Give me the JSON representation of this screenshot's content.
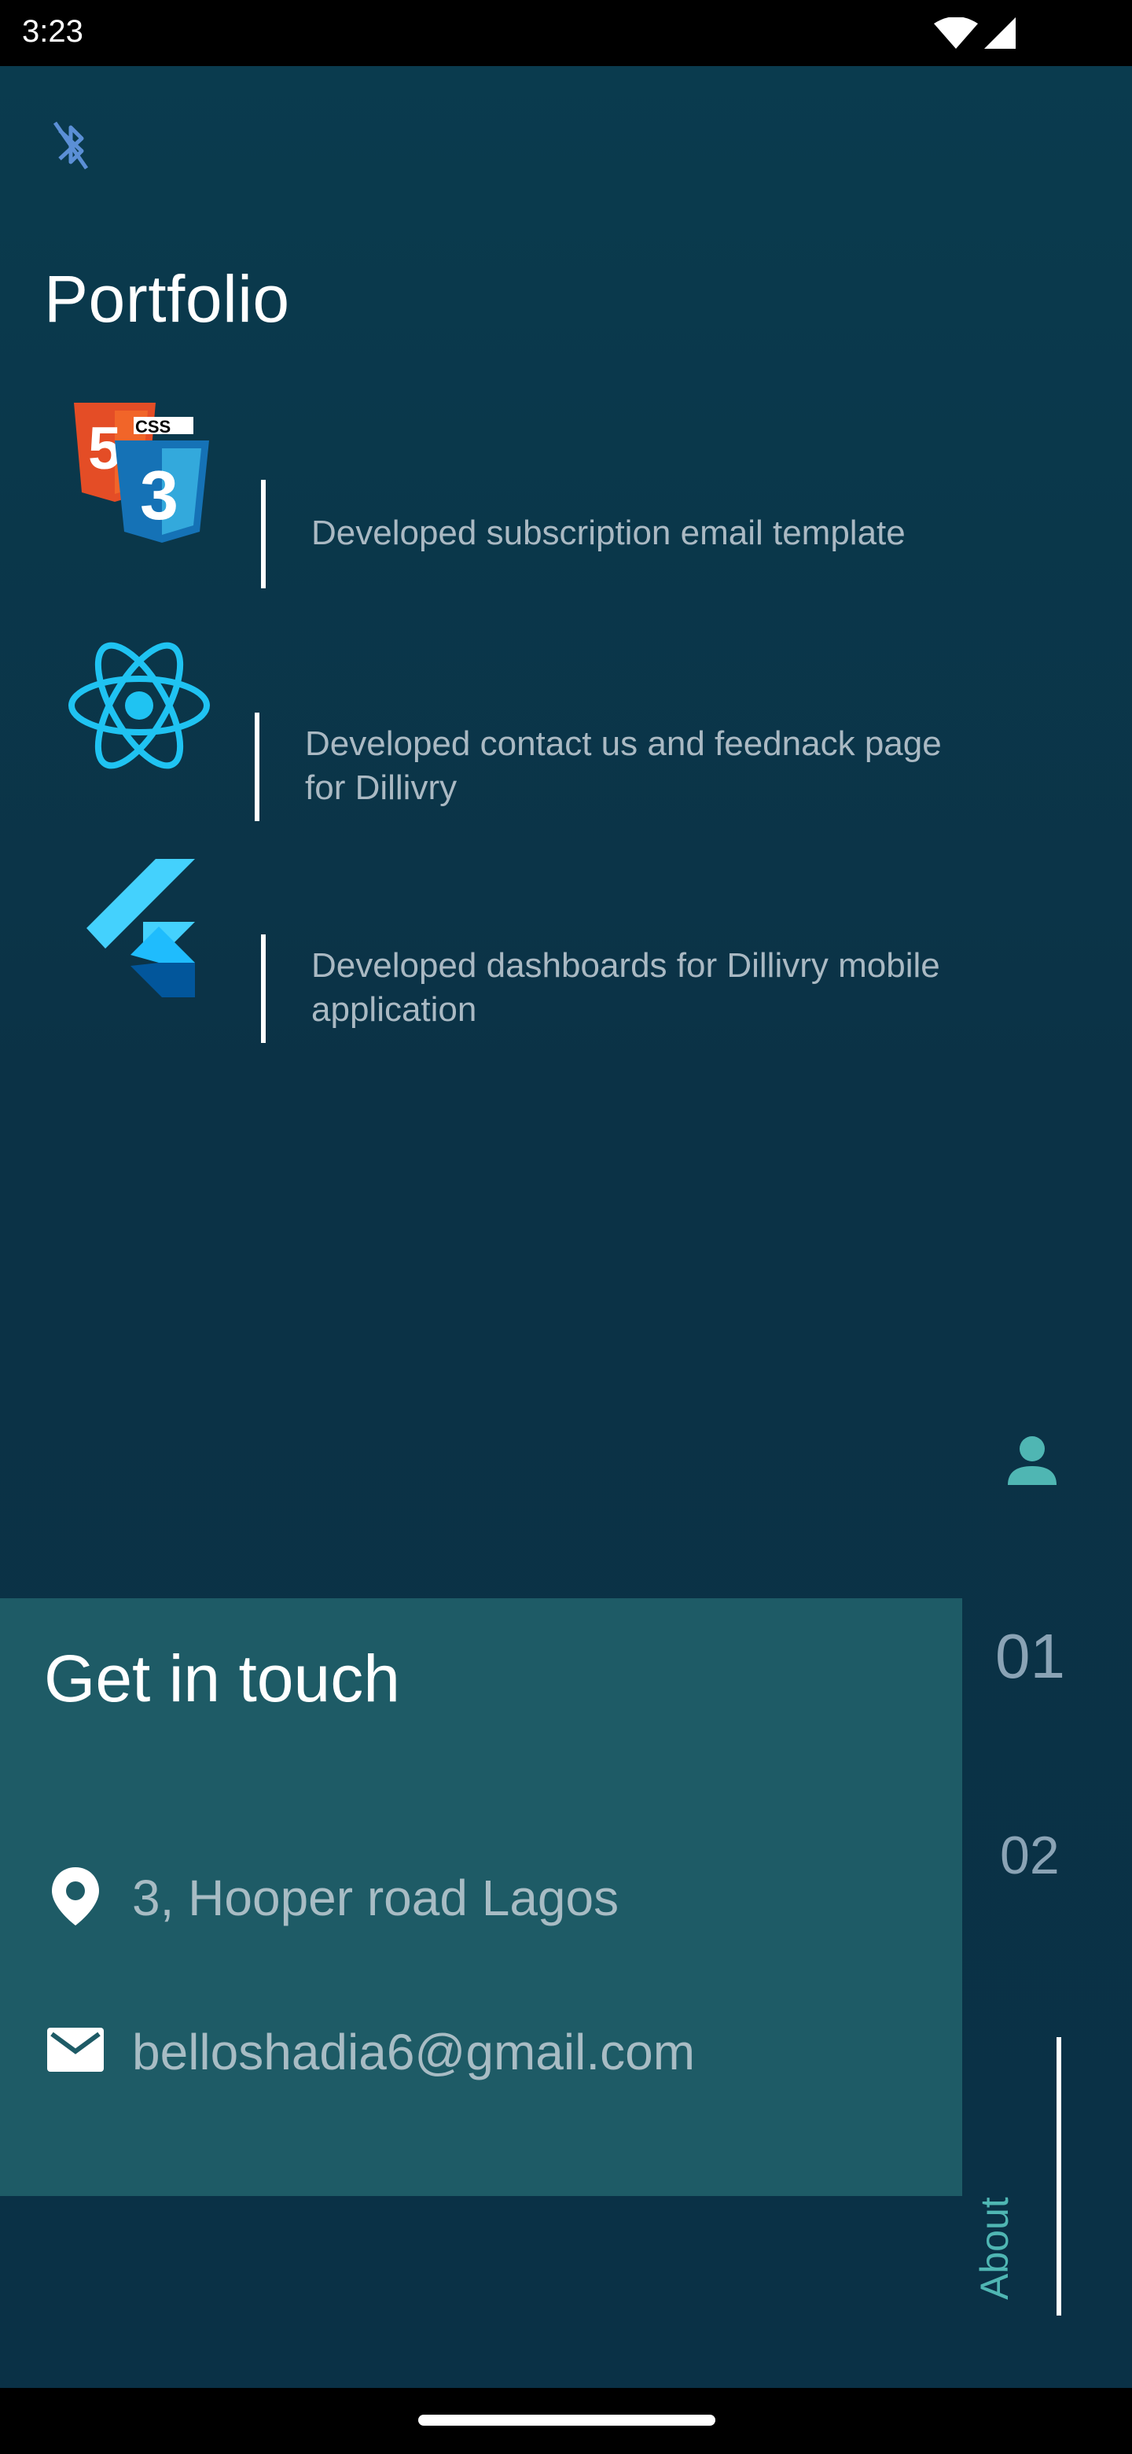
{
  "status_bar": {
    "time": "3:23"
  },
  "portfolio": {
    "title": "Portfolio",
    "items": [
      {
        "icon": "html5-css3-logo",
        "text": "Developed subscription email template"
      },
      {
        "icon": "react-logo",
        "text": "Developed contact us and feednack page for Dillivry"
      },
      {
        "icon": "flutter-logo",
        "text": "Developed dashboards for Dillivry mobile application"
      }
    ],
    "css_badge": "CSS"
  },
  "contact": {
    "title": "Get in touch",
    "address": "3, Hooper road Lagos",
    "email": "belloshadia6@gmail.com"
  },
  "side_nav": {
    "numbers": [
      "01",
      "02"
    ],
    "label": "About"
  },
  "colors": {
    "background": "#0a3447",
    "card": "#1e5b66",
    "accent": "#4fb6b3",
    "muted_text": "#aab9c3"
  }
}
